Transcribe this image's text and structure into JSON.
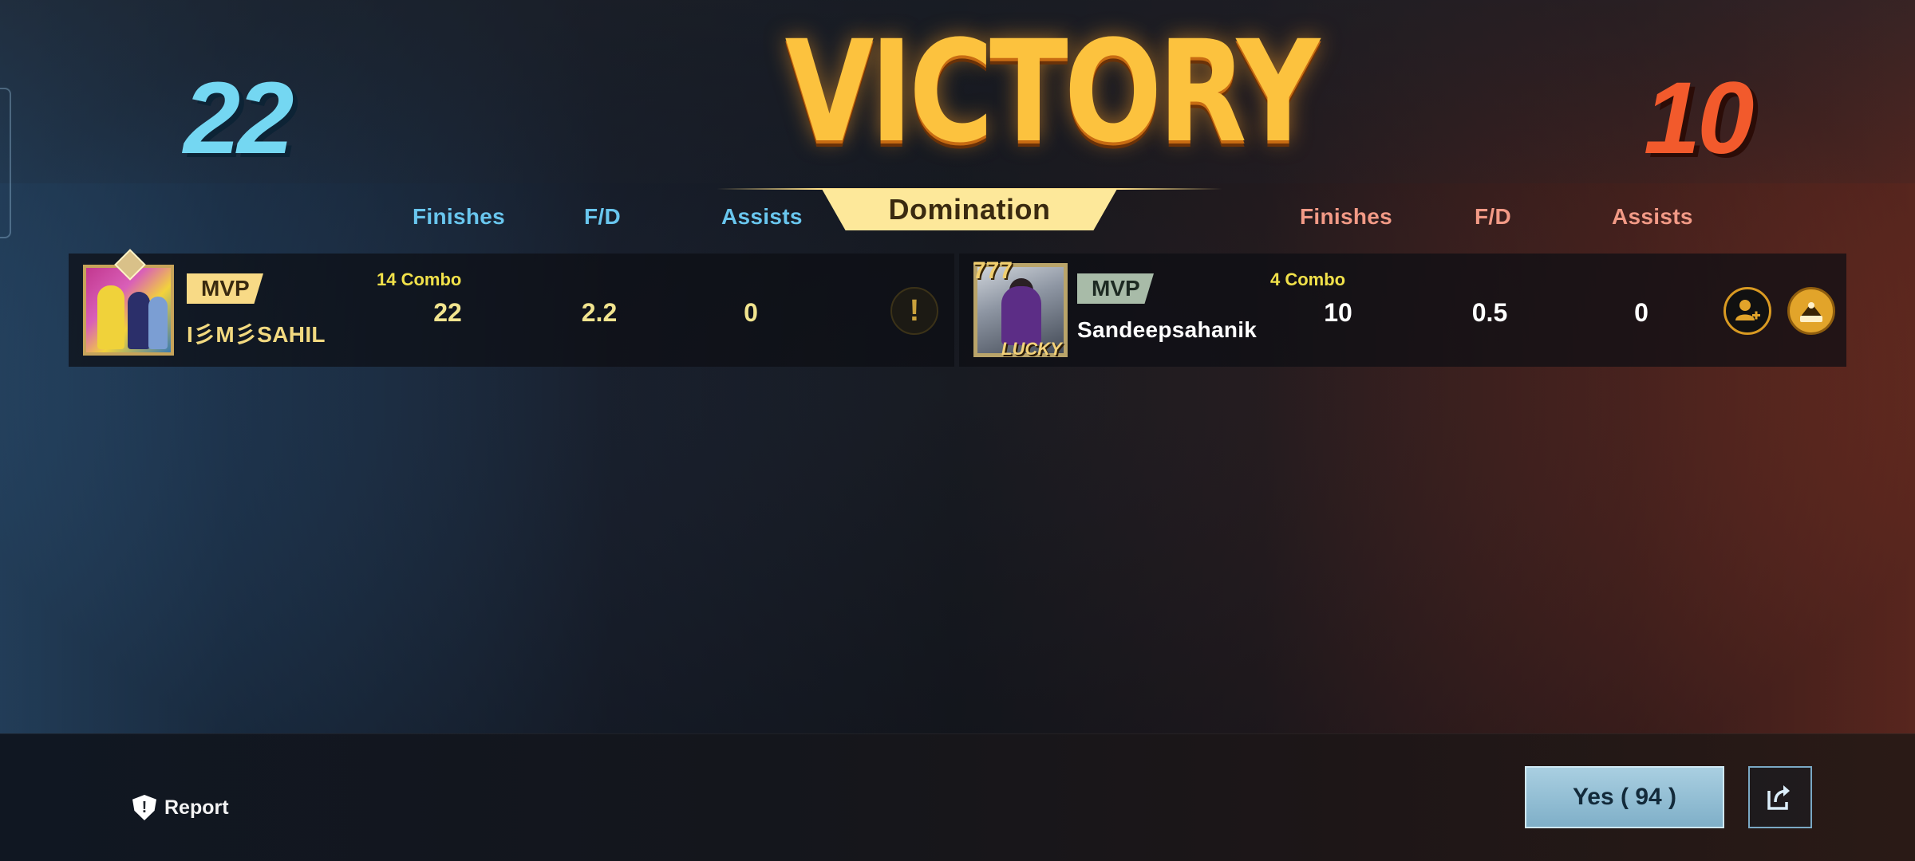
{
  "scores": {
    "team_blue": "22",
    "team_red": "10"
  },
  "result": {
    "title": "VICTORY",
    "mode": "Domination"
  },
  "headers": {
    "blue": {
      "finishes": "Finishes",
      "fd": "F/D",
      "assists": "Assists"
    },
    "red": {
      "finishes": "Finishes",
      "fd": "F/D",
      "assists": "Assists"
    }
  },
  "players": [
    {
      "badge": "MVP",
      "name": "I彡M彡SAHIL",
      "combo": "14 Combo",
      "finishes": "22",
      "fd": "2.2",
      "assists": "0",
      "action_icon": "alert-icon"
    },
    {
      "badge": "MVP",
      "name": "Sandeepsahanik",
      "avatar_text": "LUCKY",
      "avatar_sevens": "777",
      "combo": "4 Combo",
      "finishes": "10",
      "fd": "0.5",
      "assists": "0",
      "action_icons": [
        "add-friend-icon",
        "gift-icon"
      ]
    }
  ],
  "footer": {
    "report_label": "Report",
    "yes_label": "Yes ( 94 )",
    "share_icon": "share-icon"
  },
  "colors": {
    "blue_team": "#74d7f2",
    "red_team": "#f25a2c",
    "victory_gold": "#fcc23e",
    "mode_badge": "#fde89a",
    "yes_button": "#a9cfe1"
  }
}
